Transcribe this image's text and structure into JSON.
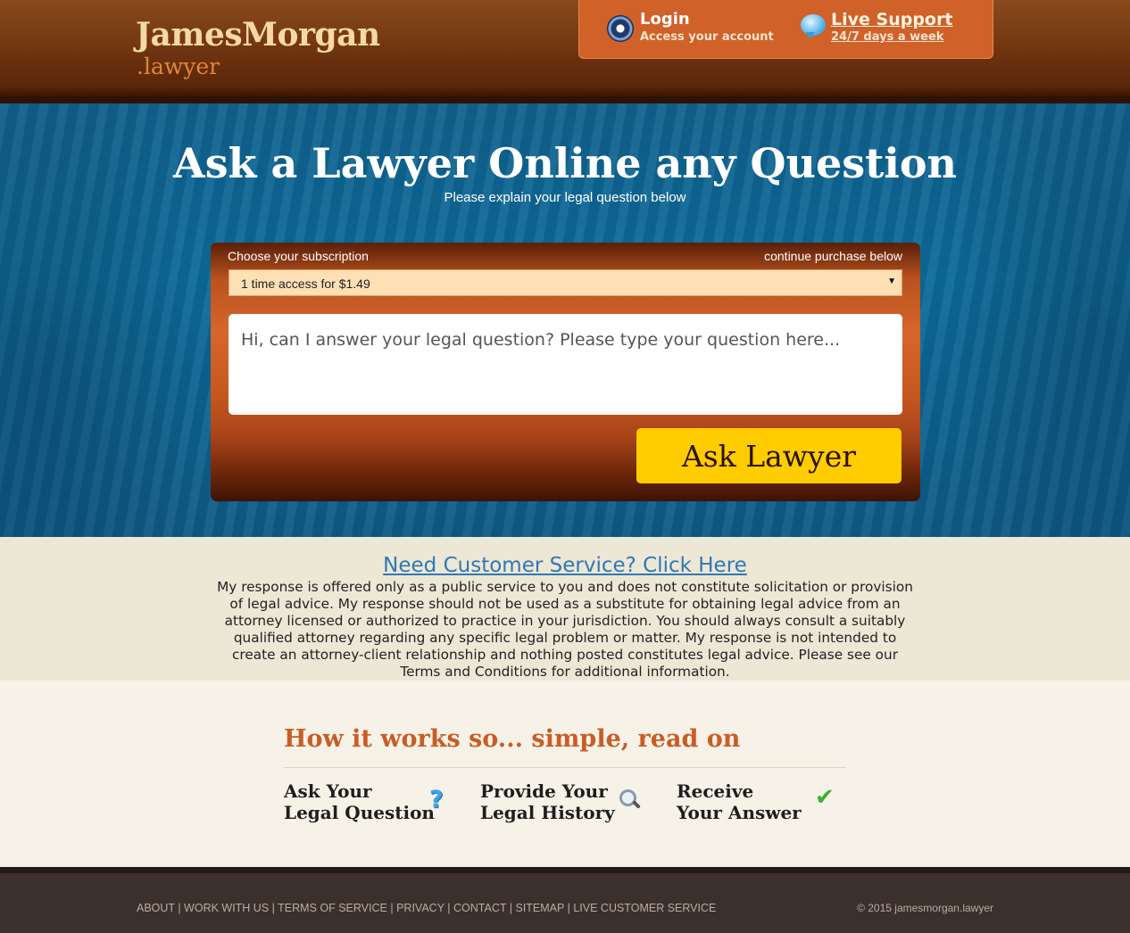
{
  "header": {
    "logo_main": "JamesMorgan",
    "logo_sub": ".lawyer",
    "login": {
      "title": "Login",
      "subtitle": "Access your account",
      "icon": "gear-icon"
    },
    "support": {
      "title": "Live Support",
      "subtitle": "24/7 days a week",
      "icon": "chat-bubble-icon"
    }
  },
  "hero": {
    "title": "Ask a Lawyer Online any Question",
    "subtitle": "Please explain your legal question below",
    "form": {
      "subscription_label": "Choose your subscription",
      "continue_label": "continue purchase below",
      "selected_option": "1 time access for $1.49",
      "question_placeholder": "Hi, can I answer your legal question? Please type your question here...",
      "submit_label": "Ask Lawyer"
    }
  },
  "disclaimer": {
    "link_text": "Need Customer Service? Click Here",
    "text": "My response is offered only as a public service to you and does not constitute solicitation or provision of legal advice. My response should not be used as a substitute for obtaining legal advice from an attorney licensed or authorized to practice in your jurisdiction. You should always consult a suitably qualified attorney regarding any specific legal problem or matter. My response is not intended to create an attorney-client relationship and nothing posted constitutes legal advice. Please see our Terms and Conditions for additional information."
  },
  "how": {
    "title": "How it works so... simple, read on",
    "steps": [
      {
        "line1": "Ask Your",
        "line2": "Legal Question",
        "icon": "question-mark-icon"
      },
      {
        "line1": "Provide Your",
        "line2": "Legal History",
        "icon": "magnifier-icon"
      },
      {
        "line1": "Receive",
        "line2": "Your Answer",
        "icon": "checkmark-icon"
      }
    ]
  },
  "footer": {
    "links": [
      "ABOUT",
      "WORK WITH US",
      "TERMS OF SERVICE",
      "PRIVACY",
      "CONTACT",
      "SITEMAP",
      "LIVE CUSTOMER SERVICE"
    ],
    "separator": " | ",
    "copyright": "© 2015 jamesmorgan.lawyer"
  },
  "colors": {
    "header_brown": "#6e3410",
    "accent_orange": "#cf6129",
    "hero_blue": "#0c6a99",
    "button_yellow": "#ffcc00",
    "link_blue": "#2e78b5",
    "heading_orange": "#c95d26"
  }
}
